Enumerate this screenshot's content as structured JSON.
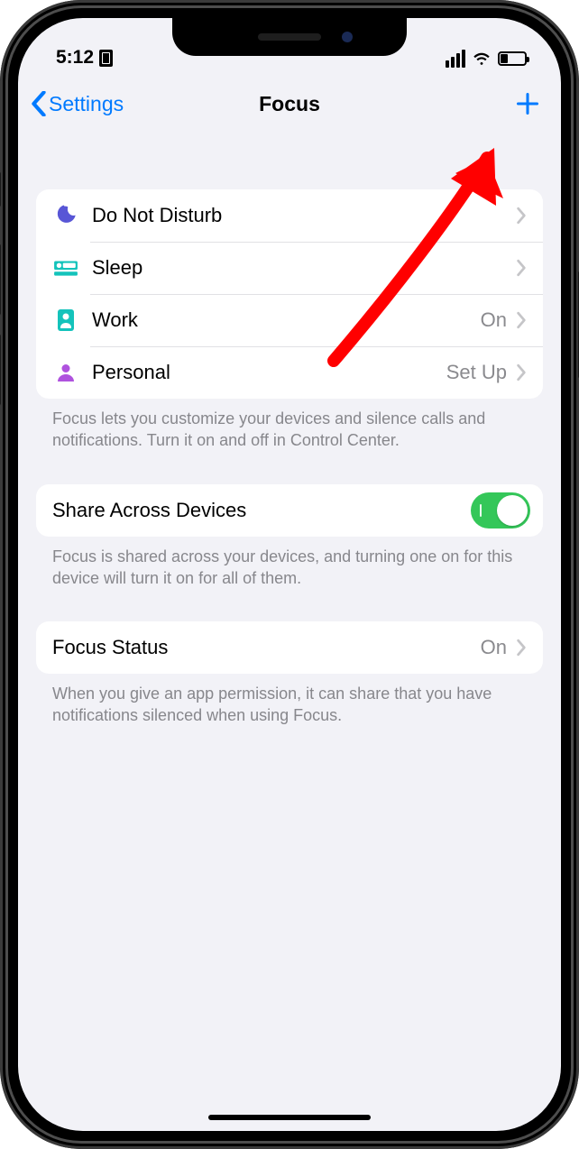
{
  "status": {
    "time": "5:12",
    "battery_pct": 30
  },
  "nav": {
    "back_label": "Settings",
    "title": "Focus"
  },
  "focus_modes": [
    {
      "key": "dnd",
      "label": "Do Not Disturb",
      "value": "",
      "icon_color": "#5856d6"
    },
    {
      "key": "sleep",
      "label": "Sleep",
      "value": "",
      "icon_color": "#14c3bb"
    },
    {
      "key": "work",
      "label": "Work",
      "value": "On",
      "icon_color": "#14c3bb"
    },
    {
      "key": "personal",
      "label": "Personal",
      "value": "Set Up",
      "icon_color": "#af52de"
    }
  ],
  "focus_footer": "Focus lets you customize your devices and silence calls and notifications. Turn it on and off in Control Center.",
  "share": {
    "label": "Share Across Devices",
    "on": true,
    "footer": "Focus is shared across your devices, and turning one on for this device will turn it on for all of them."
  },
  "status_row": {
    "label": "Focus Status",
    "value": "On",
    "footer": "When you give an app permission, it can share that you have notifications silenced when using Focus."
  }
}
